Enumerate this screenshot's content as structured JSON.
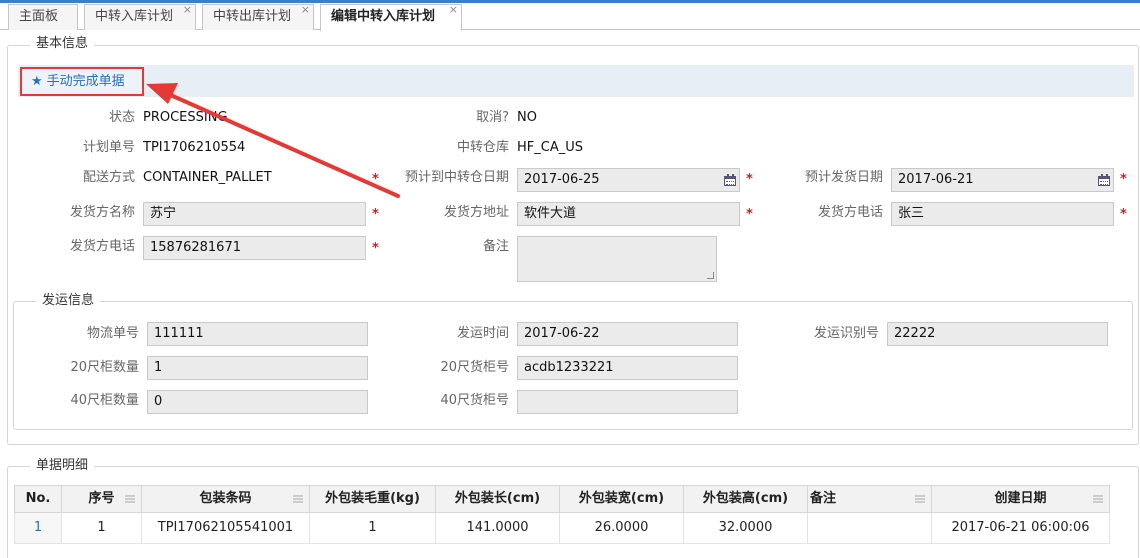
{
  "tabs": [
    {
      "label": "主面板"
    },
    {
      "label": "中转入库计划",
      "close": "×"
    },
    {
      "label": "中转出库计划",
      "close": "×"
    },
    {
      "label": "编辑中转入库计划",
      "close": "×"
    }
  ],
  "basic": {
    "legend": "基本信息",
    "complete_button": "手动完成单据",
    "status_label": "状态",
    "status_value": "PROCESSING",
    "cancel_label": "取消?",
    "cancel_value": "NO",
    "plan_no_label": "计划单号",
    "plan_no_value": "TPI1706210554",
    "warehouse_label": "中转仓库",
    "warehouse_value": "HF_CA_US",
    "delivery_label": "配送方式",
    "delivery_value": "CONTAINER_PALLET",
    "eta_label": "预计到中转仓日期",
    "eta_value": "2017-06-25",
    "ship_date_label": "预计发货日期",
    "ship_date_value": "2017-06-21",
    "shipper_name_label": "发货方名称",
    "shipper_name_value": "苏宁",
    "shipper_addr_label": "发货方地址",
    "shipper_addr_value": "软件大道",
    "shipper_phone_label": "发货方电话",
    "shipper_phone_value": "张三",
    "shipper_tel_label": "发货方电话",
    "shipper_tel_value": "15876281671",
    "remark_label": "备注",
    "remark_value": "",
    "required_mark": "*"
  },
  "shipping": {
    "legend": "发运信息",
    "tracking_label": "物流单号",
    "tracking_value": "111111",
    "ship_time_label": "发运时间",
    "ship_time_value": "2017-06-22",
    "ship_id_label": "发运识别号",
    "ship_id_value": "22222",
    "c20_qty_label": "20尺柜数量",
    "c20_qty_value": "1",
    "c20_no_label": "20尺货柜号",
    "c20_no_value": "acdb1233221",
    "c40_qty_label": "40尺柜数量",
    "c40_qty_value": "0",
    "c40_no_label": "40尺货柜号",
    "c40_no_value": ""
  },
  "details": {
    "legend": "单据明细",
    "columns": [
      "No.",
      "序号",
      "包装条码",
      "外包装毛重(kg)",
      "外包装长(cm)",
      "外包装宽(cm)",
      "外包装高(cm)",
      "备注",
      "创建日期"
    ],
    "rows": [
      [
        "1",
        "1",
        "TPI17062105541001",
        "1",
        "141.0000",
        "26.0000",
        "32.0000",
        "",
        "2017-06-21 06:00:06"
      ]
    ]
  },
  "colors": {
    "accent": "#3b7fc4",
    "annotation": "#e53935"
  },
  "icons": {
    "star": "star-icon",
    "calendar": "calendar-icon"
  }
}
